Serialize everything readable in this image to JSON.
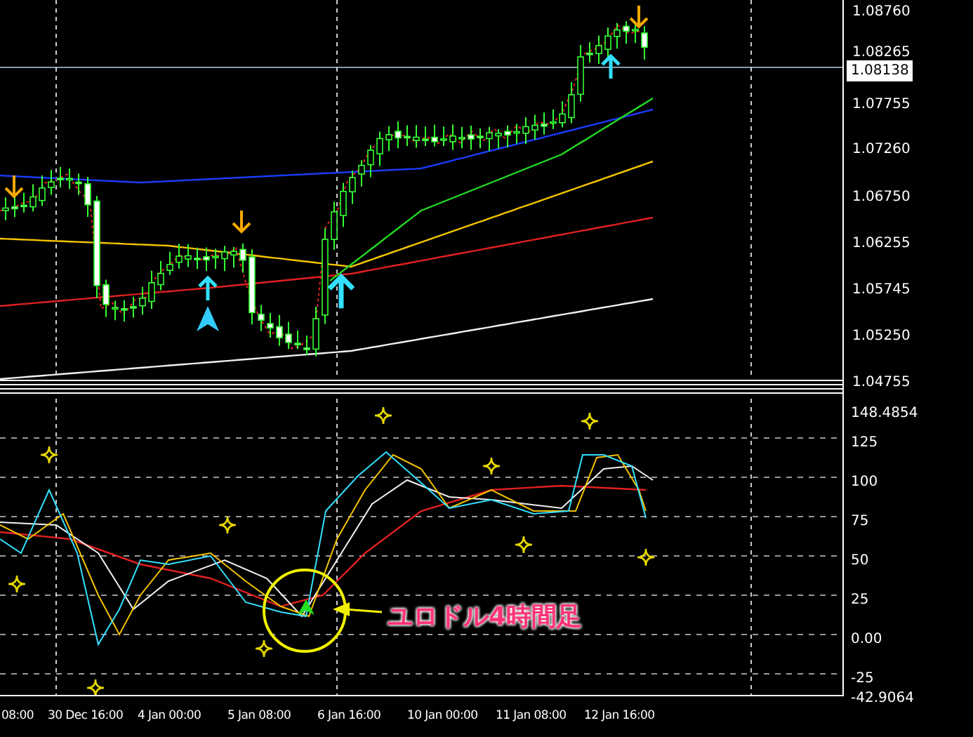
{
  "price_axis": {
    "labels": [
      "1.08760",
      "1.08265",
      "1.07755",
      "1.07260",
      "1.06750",
      "1.06255",
      "1.05745",
      "1.05250",
      "1.04755"
    ],
    "current_price": "1.08138"
  },
  "indicator_axis": {
    "labels": [
      "148.4854",
      "125",
      "100",
      "75",
      "50",
      "25",
      "0.00",
      "-25",
      "-42.9064"
    ]
  },
  "time_axis": {
    "labels": [
      "08:00",
      "30 Dec 16:00",
      "4 Jan 00:00",
      "5 Jan 08:00",
      "6 Jan 16:00",
      "10 Jan 00:00",
      "11 Jan 08:00",
      "12 Jan 16:00"
    ]
  },
  "annotation": {
    "text": "ユロドル4時間足"
  }
}
